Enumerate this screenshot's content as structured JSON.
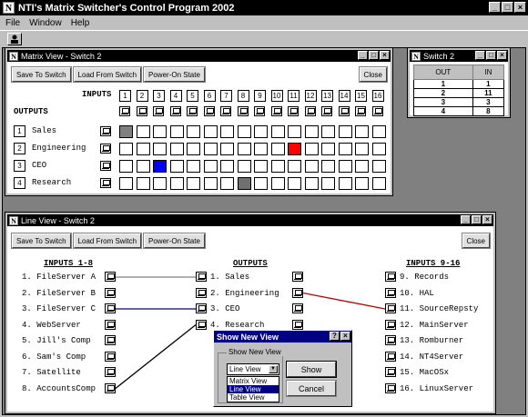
{
  "app": {
    "title": "NTI's Matrix Switcher's Control Program 2002",
    "logo": "N"
  },
  "menu": [
    "File",
    "Window",
    "Help"
  ],
  "matrix_window": {
    "title": "Matrix View - Switch 2",
    "buttons": {
      "save": "Save To Switch",
      "load": "Load From Switch",
      "power": "Power-On State",
      "close": "Close"
    },
    "inputs_label": "INPUTS",
    "outputs_label": "OUTPUTS",
    "input_numbers": [
      "1",
      "2",
      "3",
      "4",
      "5",
      "6",
      "7",
      "8",
      "9",
      "10",
      "11",
      "12",
      "13",
      "14",
      "15",
      "16"
    ],
    "outputs": [
      {
        "num": "1",
        "name": "Sales",
        "active_input": 1,
        "color": "#808080"
      },
      {
        "num": "2",
        "name": "Engineering",
        "active_input": 11,
        "color": "#ff0000"
      },
      {
        "num": "3",
        "name": "CEO",
        "active_input": 3,
        "color": "#0000ff"
      },
      {
        "num": "4",
        "name": "Research",
        "active_input": 8,
        "color": "#707070"
      }
    ]
  },
  "switch_window": {
    "title": "Switch 2",
    "headers": {
      "out": "OUT",
      "in": "IN"
    },
    "rows": [
      [
        "1",
        "1"
      ],
      [
        "2",
        "11"
      ],
      [
        "3",
        "3"
      ],
      [
        "4",
        "8"
      ]
    ]
  },
  "line_window": {
    "title": "Line View - Switch 2",
    "buttons": {
      "save": "Save To Switch",
      "load": "Load From Switch",
      "power": "Power-On State",
      "close": "Close"
    },
    "inputs_left_label": "INPUTS 1-8",
    "outputs_label": "OUTPUTS",
    "inputs_right_label": "INPUTS 9-16",
    "inputs_left": [
      "1. FileServer A",
      "2. FileServer B",
      "3. FileServer C",
      "4. WebServer",
      "5. Jill's Comp",
      "6. Sam's Comp",
      "7. Satellite",
      "8. AccountsComp"
    ],
    "outputs": [
      "1. Sales",
      "2. Engineering",
      "3. CEO",
      "4. Research"
    ],
    "inputs_right": [
      "9. Records",
      "10. HAL",
      "11. SourceRepsty",
      "12. MainServer",
      "13. Romburner",
      "14. NT4Server",
      "15. MacOSx",
      "16. LinuxServer"
    ],
    "connections": [
      {
        "input": 1,
        "output": 1,
        "color": "#808080"
      },
      {
        "input": 3,
        "output": 3,
        "color": "#0000a0"
      },
      {
        "input": 8,
        "output": 4,
        "color": "#000000"
      },
      {
        "input": 11,
        "output": 2,
        "color": "#c00000"
      }
    ]
  },
  "dialog": {
    "title": "Show New View",
    "group_label": "Show New View",
    "selected": "Line View",
    "options": [
      "Matrix View",
      "Line View",
      "Table View"
    ],
    "highlighted": "Line View",
    "show_button": "Show",
    "cancel_button": "Cancel"
  }
}
